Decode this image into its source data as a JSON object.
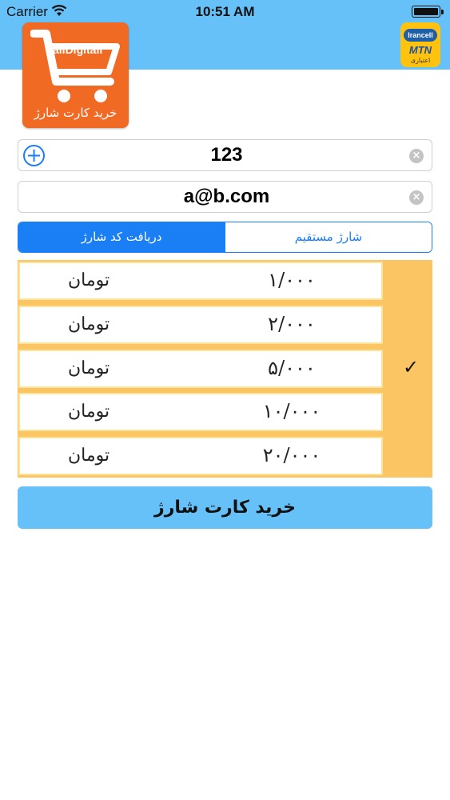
{
  "status_bar": {
    "carrier": "Carrier",
    "time": "10:51 AM"
  },
  "logo": {
    "brand": "allDigitall",
    "caption": "خرید کارت شارژ"
  },
  "operator": {
    "top": "Irancell",
    "middle": "MTN",
    "bottom": "اعتباری"
  },
  "phone_field": {
    "value": "123"
  },
  "email_field": {
    "value": "a@b.com"
  },
  "tabs": [
    {
      "label": "دریافت کد شارژ",
      "selected": true
    },
    {
      "label": "شارژ مستقیم",
      "selected": false
    }
  ],
  "amounts": [
    {
      "value": "۱/۰۰۰",
      "currency": "تومان",
      "checked": false
    },
    {
      "value": "۲/۰۰۰",
      "currency": "تومان",
      "checked": false
    },
    {
      "value": "۵/۰۰۰",
      "currency": "تومان",
      "checked": true,
      "check_mark": "✓"
    },
    {
      "value": "۱۰/۰۰۰",
      "currency": "تومان",
      "checked": false
    },
    {
      "value": "۲۰/۰۰۰",
      "currency": "تومان",
      "checked": false
    }
  ],
  "buy_button": {
    "label": "خرید کارت شارژ"
  },
  "colors": {
    "header": "#66c1f9",
    "accent": "#1a7ef5",
    "list_bg": "#fbc563",
    "logo_bg": "#f16a24"
  }
}
